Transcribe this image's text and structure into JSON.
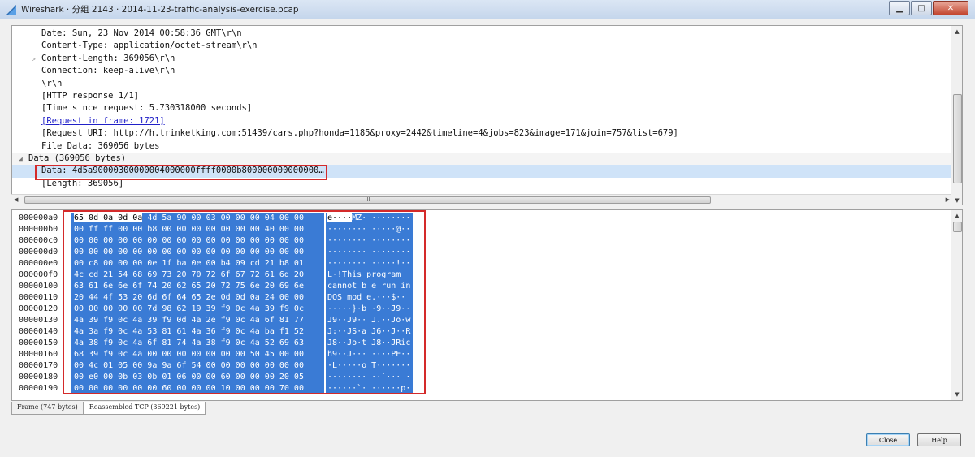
{
  "window": {
    "title": "Wireshark · 分组 2143 · 2014-11-23-traffic-analysis-exercise.pcap",
    "minimize_label": "▁",
    "maximize_label": "□",
    "close_label": "✕"
  },
  "tree": {
    "lines": [
      {
        "text": "Date: Sun, 23 Nov 2014 00:58:36 GMT\\r\\n"
      },
      {
        "text": "Content-Type: application/octet-stream\\r\\n"
      },
      {
        "text": "Content-Length: 369056\\r\\n",
        "expander": "▷"
      },
      {
        "text": "Connection: keep-alive\\r\\n"
      },
      {
        "text": "\\r\\n"
      },
      {
        "text": "[HTTP response 1/1]"
      },
      {
        "text": "[Time since request: 5.730318000 seconds]"
      },
      {
        "text": "[Request in frame: 1721]"
      },
      {
        "text": "[Request URI: http://h.trinketking.com:51439/cars.php?honda=1185&proxy=2442&timeline=4&jobs=823&image=171&join=757&list=679]"
      },
      {
        "text": "File Data: 369056 bytes"
      },
      {
        "text": "Data (369056 bytes)",
        "expander": "◢"
      },
      {
        "text": "Data: 4d5a90000300000004000000ffff0000b800000000000000…"
      },
      {
        "text": "[Length: 369056]"
      }
    ],
    "hscroll_grip": "III"
  },
  "hex": {
    "rows": [
      {
        "offset": "000000a0",
        "hl": "65 0d 0a 0d 0a",
        "bytes": " 4d 5a 90  00 03 00 00 00 04 00 00",
        "hl_ascii": "e····",
        "ascii": "MZ· ········"
      },
      {
        "offset": "000000b0",
        "bytes": "00 ff ff 00 00 b8 00 00  00 00 00 00 00 40 00 00",
        "ascii": "········ ·····@··"
      },
      {
        "offset": "000000c0",
        "bytes": "00 00 00 00 00 00 00 00  00 00 00 00 00 00 00 00",
        "ascii": "········ ········"
      },
      {
        "offset": "000000d0",
        "bytes": "00 00 00 00 00 00 00 00  00 00 00 00 00 00 00 00",
        "ascii": "········ ········"
      },
      {
        "offset": "000000e0",
        "bytes": "00 c8 00 00 00 0e 1f ba  0e 00 b4 09 cd 21 b8 01",
        "ascii": "········ ·····!··"
      },
      {
        "offset": "000000f0",
        "bytes": "4c cd 21 54 68 69 73 20  70 72 6f 67 72 61 6d 20",
        "ascii": "L·!This  program"
      },
      {
        "offset": "00000100",
        "bytes": "63 61 6e 6e 6f 74 20 62  65 20 72 75 6e 20 69 6e",
        "ascii": "cannot b e run in"
      },
      {
        "offset": "00000110",
        "bytes": "20 44 4f 53 20 6d 6f 64  65 2e 0d 0d 0a 24 00 00",
        "ascii": " DOS mod e.···$··"
      },
      {
        "offset": "00000120",
        "bytes": "00 00 00 00 00 7d 98 62  19 39 f9 0c 4a 39 f9 0c",
        "ascii": "·····}·b ·9··J9··"
      },
      {
        "offset": "00000130",
        "bytes": "4a 39 f9 0c 4a 39 f9 0d  4a 2e f9 0c 4a 6f 81 77",
        "ascii": "J9··J9·· J.··Jo·w"
      },
      {
        "offset": "00000140",
        "bytes": "4a 3a f9 0c 4a 53 81 61  4a 36 f9 0c 4a ba f1 52",
        "ascii": "J:··JS·a J6··J··R"
      },
      {
        "offset": "00000150",
        "bytes": "4a 38 f9 0c 4a 6f 81 74  4a 38 f9 0c 4a 52 69 63",
        "ascii": "J8··Jo·t J8··JRic"
      },
      {
        "offset": "00000160",
        "bytes": "68 39 f9 0c 4a 00 00 00  00 00 00 00 50 45 00 00",
        "ascii": "h9··J··· ····PE··"
      },
      {
        "offset": "00000170",
        "bytes": "00 4c 01 05 00 9a 9a 6f  54 00 00 00 00 00 00 00",
        "ascii": "·L·····o T·······"
      },
      {
        "offset": "00000180",
        "bytes": "00 e0 00 0b 03 0b 01 06  00 00 60 00 00 00 20 05",
        "ascii": "········ ··`··· ·"
      },
      {
        "offset": "00000190",
        "bytes": "00 00 00 00 00 00 60 00  00 00 10 00 00 00 70 00",
        "ascii": "······`· ······p·"
      }
    ]
  },
  "tabs": [
    "Frame (747 bytes)",
    "Reassembled TCP (369221 bytes)"
  ],
  "buttons": {
    "close": "Close",
    "help": "Help"
  },
  "colors": {
    "selection": "#3a7bd5",
    "highlight_box": "#d42a2a",
    "link": "#2020c8"
  }
}
